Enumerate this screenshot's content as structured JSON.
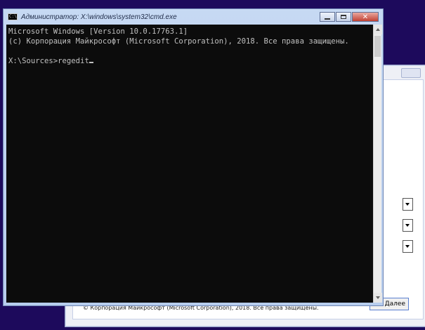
{
  "setup": {
    "copyright": "© Корпорация Майкрософт (Microsoft Corporation), 2018. Все права защищены.",
    "next_button": "Далее"
  },
  "cmd": {
    "title": "Администратор: X:\\windows\\system32\\cmd.exe",
    "icon_text": "C:\\",
    "close_glyph": "✕",
    "lines": [
      "Microsoft Windows [Version 10.0.17763.1]",
      "(c) Корпорация Майкрософт (Microsoft Corporation), 2018. Все права защищены.",
      ""
    ],
    "prompt": "X:\\Sources>",
    "input": "regedit"
  },
  "icons": {
    "cmd": "console-icon",
    "minimize": "minimize-icon",
    "maximize": "maximize-icon",
    "close": "close-icon"
  }
}
